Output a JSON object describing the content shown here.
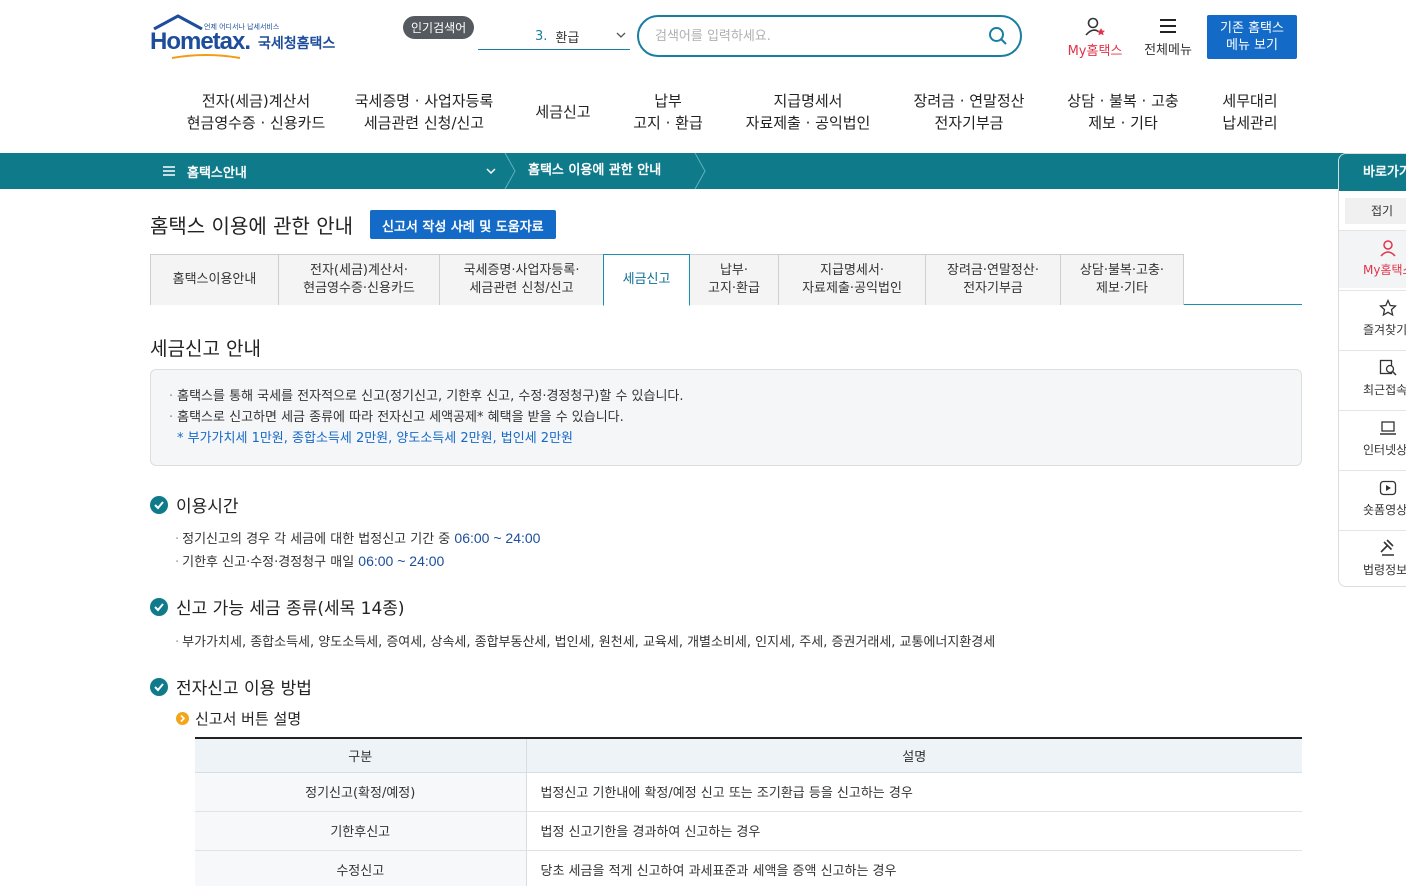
{
  "header": {
    "logo_text": "Hometax.",
    "logo_small": "언제 어디서나 납세서비스",
    "logo_kr": "국세청홈택스",
    "popular_badge": "인기검색어",
    "popular_rank": "3.",
    "popular_keyword": "환급",
    "search_placeholder": "검색어를 입력하세요.",
    "my_hometax": "My홈택스",
    "all_menu": "전체메뉴",
    "old_menu_line1": "기존 홈택스",
    "old_menu_line2": "메뉴 보기"
  },
  "gnb": [
    {
      "l1": "전자(세금)계산서",
      "l2": "현금영수증 · 신용카드"
    },
    {
      "l1": "국세증명 · 사업자등록",
      "l2": "세금관련 신청/신고"
    },
    {
      "l1": "세금신고",
      "l2": ""
    },
    {
      "l1": "납부",
      "l2": "고지 · 환급"
    },
    {
      "l1": "지급명세서",
      "l2": "자료제출 · 공익법인"
    },
    {
      "l1": "장려금 · 연말정산",
      "l2": "전자기부금"
    },
    {
      "l1": "상담 · 불복 · 고충",
      "l2": "제보 · 기타"
    },
    {
      "l1": "세무대리",
      "l2": "납세관리"
    }
  ],
  "breadcrumb": {
    "level1": "홈택스안내",
    "level2": "홈택스 이용에 관한 안내"
  },
  "page": {
    "title": "홈택스 이용에 관한 안내",
    "help_button": "신고서 작성 사례 및 도움자료"
  },
  "tabs": [
    {
      "l1": "홈택스이용안내",
      "l2": ""
    },
    {
      "l1": "전자(세금)계산서·",
      "l2": "현금영수증·신용카드"
    },
    {
      "l1": "국세증명·사업자등록·",
      "l2": "세금관련 신청/신고"
    },
    {
      "l1": "세금신고",
      "l2": ""
    },
    {
      "l1": "납부·",
      "l2": "고지·환급"
    },
    {
      "l1": "지급명세서·",
      "l2": "자료제출·공익법인"
    },
    {
      "l1": "장려금·연말정산·",
      "l2": "전자기부금"
    },
    {
      "l1": "상담·불복·고충·",
      "l2": "제보·기타"
    }
  ],
  "section": {
    "title": "세금신고 안내",
    "info1": "홈택스를 통해 국세를 전자적으로 신고(정기신고, 기한후 신고, 수정·경정청구)할 수 있습니다.",
    "info2": "홈택스로 신고하면 세금 종류에 따라 전자신고 세액공제* 혜택을 받을 수 있습니다.",
    "info_note": "* 부가가치세 1만원, 종합소득세 2만원, 양도소득세 2만원, 법인세 2만원"
  },
  "usage_time": {
    "title": "이용시간",
    "line1_text": "정기신고의 경우 각 세금에 대한 법정신고 기간 중",
    "line1_time": "06:00 ~ 24:00",
    "line2_text": "기한후 신고·수정·경정청구 매일",
    "line2_time": "06:00 ~ 24:00"
  },
  "tax_types": {
    "title": "신고 가능 세금 종류(세목 14종)",
    "list": "부가가치세, 종합소득세, 양도소득세, 증여세, 상속세, 종합부동산세, 법인세, 원천세, 교육세, 개별소비세, 인지세, 주세, 증권거래세, 교통에너지환경세"
  },
  "method": {
    "title": "전자신고 이용 방법",
    "subtitle": "신고서 버튼 설명",
    "table_headers": [
      "구분",
      "설명"
    ],
    "rows": [
      {
        "k": "정기신고(확정/예정)",
        "v": "법정신고 기한내에 확정/예정 신고 또는 조기환급 등을 신고하는 경우"
      },
      {
        "k": "기한후신고",
        "v": "법정 신고기한을 경과하여 신고하는 경우"
      },
      {
        "k": "수정신고",
        "v": "당초 세금을 적게 신고하여 과세표준과 세액을 증액 신고하는 경우"
      }
    ]
  },
  "quick": {
    "title": "바로가기",
    "fold": "접기",
    "items": [
      "My홈택스",
      "즐겨찾기",
      "최근접속메뉴",
      "인터넷상담",
      "숏폼영상",
      "법령정보"
    ]
  },
  "colors": {
    "teal": "#0e7a8a",
    "blue_button": "#136ac7",
    "accent_red": "#e0344a",
    "time_blue": "#1d4d9b"
  }
}
